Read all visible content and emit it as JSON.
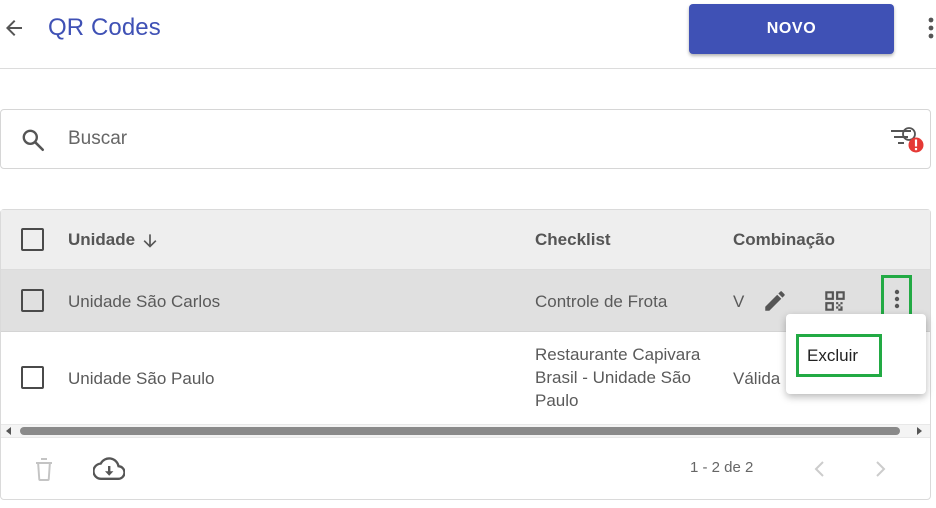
{
  "header": {
    "title": "QR Codes",
    "new_button_label": "NOVO",
    "back_icon": "arrow-left-icon",
    "more_icon": "more-vertical-icon"
  },
  "search": {
    "placeholder": "Buscar",
    "value": "",
    "search_icon": "search-icon",
    "filter_icon": "filter-alert-icon"
  },
  "table": {
    "columns": [
      "Unidade",
      "Checklist",
      "Combinação"
    ],
    "sort_column": "Unidade",
    "sort_direction": "descending",
    "rows": [
      {
        "unidade": "Unidade São Carlos",
        "checklist": "Controle de Frota",
        "combinacao": "V",
        "checklist_lines": [
          "Controle de Frota"
        ]
      },
      {
        "unidade": "Unidade São Paulo",
        "checklist": "Restaurante Capivara Brasil - Unidade São Paulo",
        "combinacao": "Válida",
        "checklist_lines": [
          "Restaurante Capivara",
          "Brasil - Unidade São",
          "Paulo"
        ]
      }
    ]
  },
  "row_menu": {
    "items": [
      "Excluir"
    ]
  },
  "footer": {
    "pagination": "1 - 2 de 2",
    "delete_icon": "trash-icon",
    "download_icon": "cloud-download-icon"
  },
  "colors": {
    "primary": "#3f51b5",
    "highlight": "#22aa44",
    "alert": "#e53935",
    "header_bg": "#eeeeee",
    "selected_row_bg": "#e0e0e0"
  }
}
